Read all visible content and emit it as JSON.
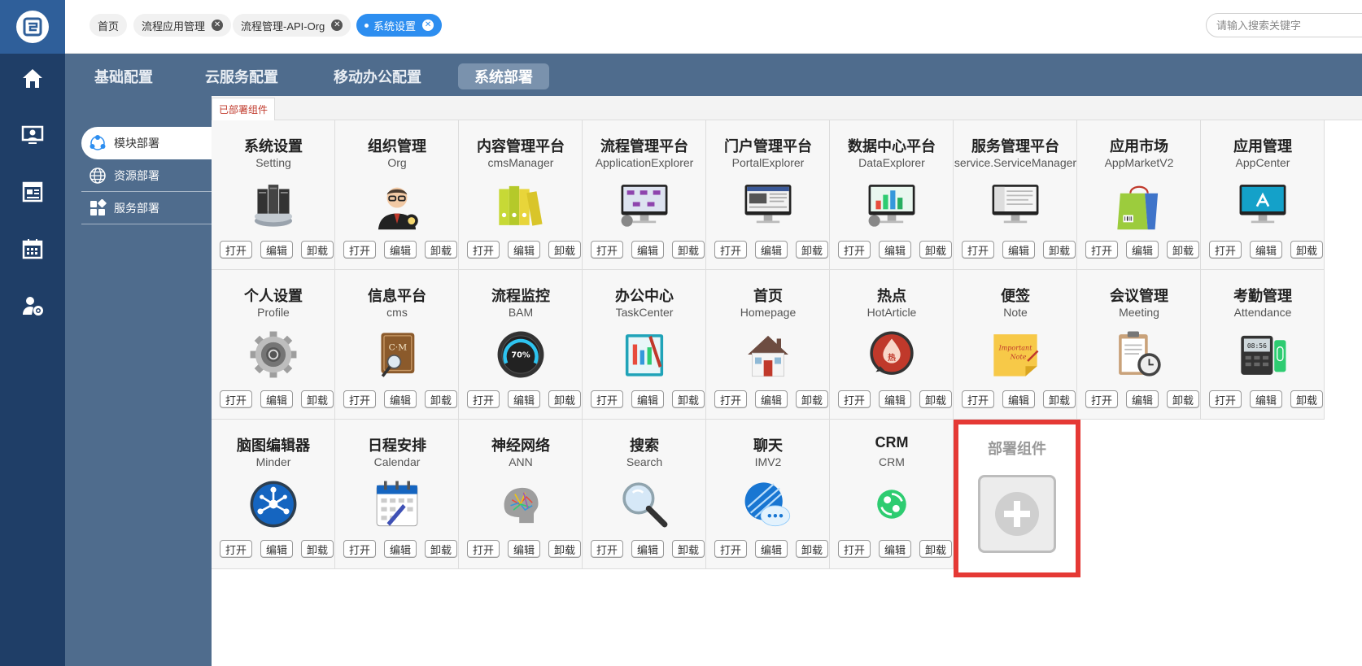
{
  "nav": {
    "icons": [
      "home-icon",
      "monitor-user-icon",
      "news-icon",
      "calendar-icon",
      "user-settings-icon"
    ]
  },
  "tabs": [
    {
      "label": "首页",
      "closable": false
    },
    {
      "label": "流程应用管理",
      "closable": true
    },
    {
      "label": "流程管理-API-Org",
      "closable": true
    },
    {
      "label": "系统设置",
      "closable": true,
      "active": true
    }
  ],
  "search": {
    "placeholder": "请输入搜索关键字"
  },
  "menubar": {
    "items": [
      "基础配置",
      "云服务配置",
      "移动办公配置",
      "系统部署"
    ],
    "active": "系统部署"
  },
  "sidebar": {
    "items": [
      "模块部署",
      "资源部署",
      "服务部署"
    ],
    "active": "模块部署"
  },
  "content": {
    "tab_label": "已部署组件",
    "button_labels": {
      "open": "打开",
      "edit": "编辑",
      "uninstall": "卸载"
    },
    "modules": [
      {
        "name": "系统设置",
        "code": "Setting",
        "icon": "server-stack-icon"
      },
      {
        "name": "组织管理",
        "code": "Org",
        "icon": "manager-icon"
      },
      {
        "name": "内容管理平台",
        "code": "cmsManager",
        "icon": "binders-icon"
      },
      {
        "name": "流程管理平台",
        "code": "ApplicationExplorer",
        "icon": "flow-monitor-icon"
      },
      {
        "name": "门户管理平台",
        "code": "PortalExplorer",
        "icon": "portal-monitor-icon"
      },
      {
        "name": "数据中心平台",
        "code": "DataExplorer",
        "icon": "data-monitor-icon"
      },
      {
        "name": "服务管理平台",
        "code": "service.ServiceManager",
        "icon": "service-monitor-icon"
      },
      {
        "name": "应用市场",
        "code": "AppMarketV2",
        "icon": "shopping-bag-icon"
      },
      {
        "name": "应用管理",
        "code": "AppCenter",
        "icon": "appstore-monitor-icon"
      },
      {
        "name": "个人设置",
        "code": "Profile",
        "icon": "gear-icon"
      },
      {
        "name": "信息平台",
        "code": "cms",
        "icon": "cms-book-icon"
      },
      {
        "name": "流程监控",
        "code": "BAM",
        "icon": "gauge-icon"
      },
      {
        "name": "办公中心",
        "code": "TaskCenter",
        "icon": "notebook-icon"
      },
      {
        "name": "首页",
        "code": "Homepage",
        "icon": "house-icon"
      },
      {
        "name": "热点",
        "code": "HotArticle",
        "icon": "hotspot-icon"
      },
      {
        "name": "便签",
        "code": "Note",
        "icon": "sticky-note-icon"
      },
      {
        "name": "会议管理",
        "code": "Meeting",
        "icon": "clipboard-clock-icon"
      },
      {
        "name": "考勤管理",
        "code": "Attendance",
        "icon": "fingerprint-device-icon"
      },
      {
        "name": "脑图编辑器",
        "code": "Minder",
        "icon": "mindmap-icon"
      },
      {
        "name": "日程安排",
        "code": "Calendar",
        "icon": "calendar-schedule-icon"
      },
      {
        "name": "神经网络",
        "code": "ANN",
        "icon": "brain-icon"
      },
      {
        "name": "搜索",
        "code": "Search",
        "icon": "magnifier-icon"
      },
      {
        "name": "聊天",
        "code": "IMV2",
        "icon": "chat-bubble-icon"
      },
      {
        "name": "CRM",
        "code": "CRM",
        "icon": "crm-icon"
      }
    ],
    "deploy": {
      "label": "部署组件",
      "icon": "plus-icon"
    }
  },
  "colors": {
    "nav_bg": "#1f3e67",
    "logo_bg": "#2f5f9a",
    "menu_bg": "#4f6c8d",
    "active_tab": "#2d8ef0",
    "deploy_border": "#e53935"
  }
}
